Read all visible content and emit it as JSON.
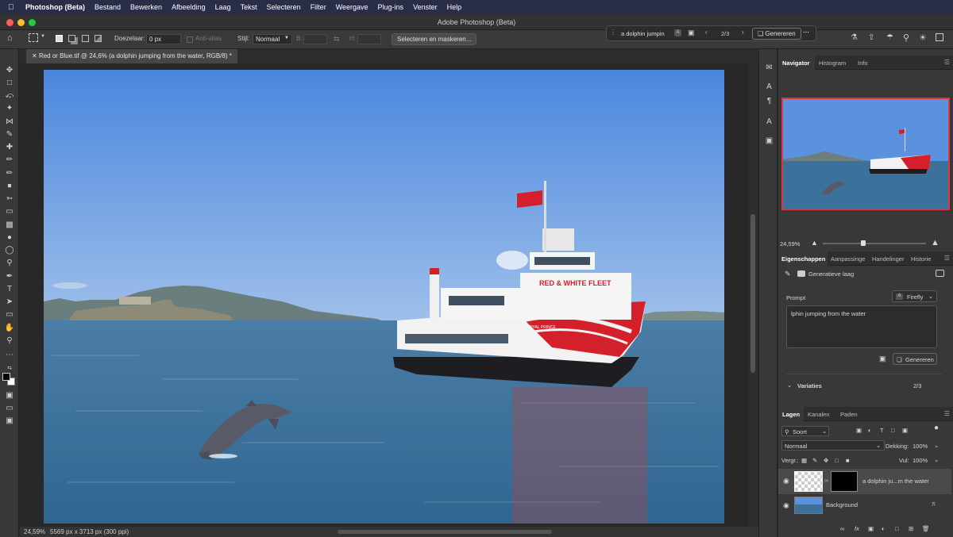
{
  "menubar": {
    "app_name": "Photoshop (Beta)",
    "items": [
      "Bestand",
      "Bewerken",
      "Afbeelding",
      "Laag",
      "Tekst",
      "Selecteren",
      "Filter",
      "Weergave",
      "Plug-ins",
      "Venster",
      "Help"
    ]
  },
  "window": {
    "title": "Adobe Photoshop (Beta)"
  },
  "options": {
    "feather_label": "Doezelaar:",
    "feather_value": "0 px",
    "antialias_label": "Anti-alias",
    "style_label": "Stijl:",
    "style_value": "Normaal",
    "width_label": "B:",
    "height_label": "H:",
    "select_mask_button": "Selecteren en maskeren..."
  },
  "contextbar": {
    "prompt": "a dolphin jumpin",
    "counter": "2/3",
    "generate_label": "Genereren"
  },
  "document": {
    "tab_title": "Red or Blue.tif @ 24,6% (a dolphin jumping from the water, RGB/8) *",
    "zoom": "24,59%",
    "info": "5569 px x 3713 px (300 ppi)",
    "boat_flag_text": "RED & WHITE FLEET",
    "boat_name": "ROYAL PRINCE"
  },
  "navigator": {
    "tabs": [
      "Navigator",
      "Histogram",
      "Info"
    ],
    "zoom": "24,59%"
  },
  "properties": {
    "tabs": [
      "Eigenschappen",
      "Aanpassinge",
      "Handelinger",
      "Historie"
    ],
    "layer_type": "Generatieve laag",
    "prompt_label": "Prompt",
    "model_label": "Firefly",
    "prompt_text": "lphin jumping from the water",
    "generate_label": "Genereren",
    "variations_label": "Variaties",
    "variations_count": "2/3"
  },
  "layers": {
    "tabs": [
      "Lagen",
      "Kanalen",
      "Paden"
    ],
    "filter_label": "Soort",
    "blend_mode": "Normaal",
    "opacity_label": "Dekking:",
    "opacity_value": "100%",
    "lock_label": "Vergr.:",
    "fill_label": "Vul:",
    "fill_value": "100%",
    "items": [
      {
        "name": "a dolphin ju...m the water"
      },
      {
        "name": "Background"
      }
    ]
  },
  "colors": {
    "accent": "#3f7fd8",
    "nav_frame": "#e0343f",
    "menubar": "#2a2d48"
  }
}
